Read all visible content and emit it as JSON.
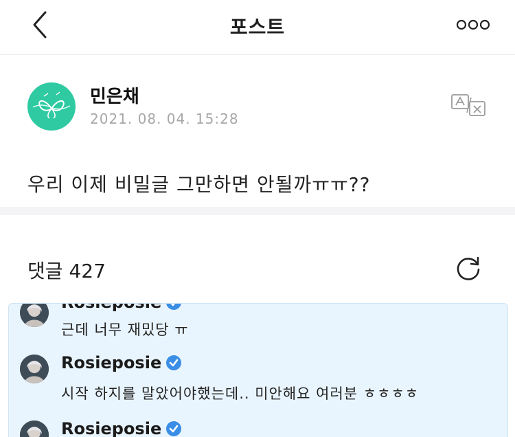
{
  "header": {
    "title": "포스트",
    "back_icon": "chevron-left-icon",
    "more_icon": "more-dots-icon"
  },
  "post": {
    "author": "민은채",
    "timestamp": "2021. 08. 04. 15:28",
    "translate_icon": "translate-icon",
    "body": "우리 이제 비밀글 그만하면 안될까ㅠㅠ??"
  },
  "comments": {
    "header_label": "댓글",
    "count": "427",
    "refresh_icon": "refresh-icon",
    "items": [
      {
        "author": "Rosieposie",
        "text": "근데 너무 재밌당 ㅠ"
      },
      {
        "author": "Rosieposie",
        "text": "시작 하지를 말았어야했는데.. 미안해요 여러분 ㅎㅎㅎㅎ"
      },
      {
        "author": "Rosieposie",
        "text": ""
      }
    ]
  },
  "colors": {
    "avatar_bg": "#2fcaa2",
    "verified_badge": "#3a8ee6",
    "comment_box_bg": "#e9f5fe",
    "timestamp_text": "#a7a7a7"
  }
}
